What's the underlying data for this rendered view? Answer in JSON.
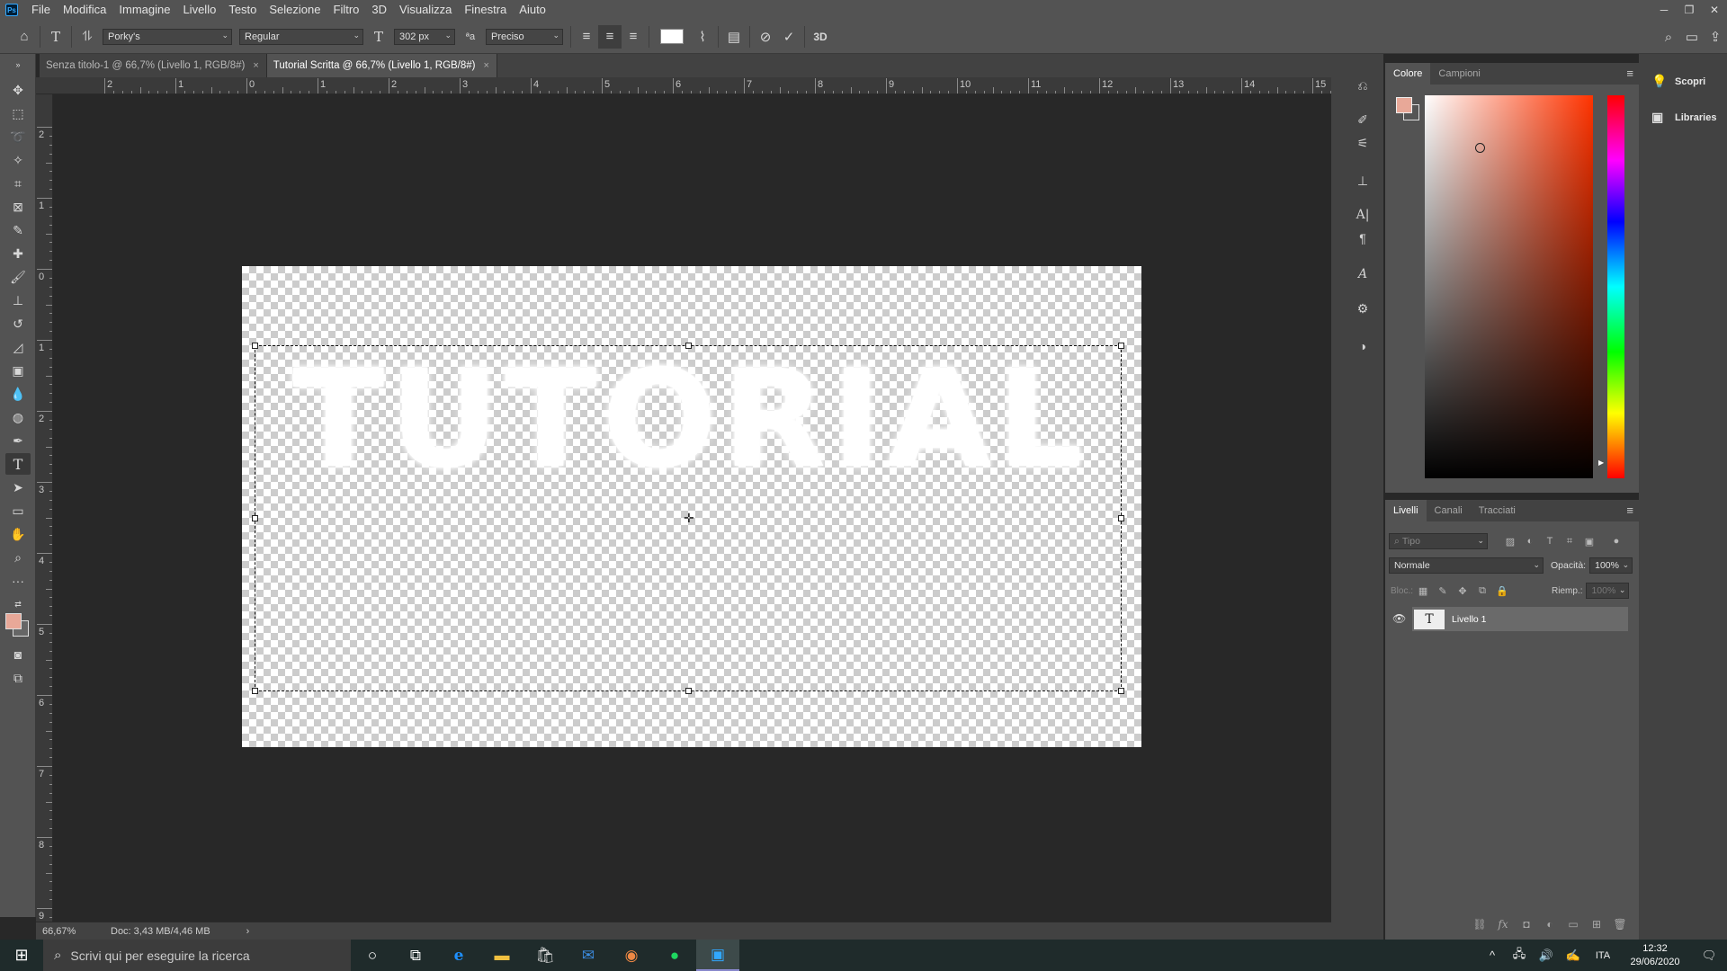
{
  "app": {
    "logo_text": "Ps",
    "name": "Adobe Photoshop"
  },
  "menu": [
    "File",
    "Modifica",
    "Immagine",
    "Livello",
    "Testo",
    "Selezione",
    "Filtro",
    "3D",
    "Visualizza",
    "Finestra",
    "Aiuto"
  ],
  "window_controls": {
    "minimize": "─",
    "restore": "❐",
    "close": "✕"
  },
  "options_bar": {
    "font_family": "Porky's",
    "font_style": "Regular",
    "font_size": "302 px",
    "antialias": "Preciso",
    "text_color": "#ffffff",
    "mode_3d": "3D"
  },
  "tabs": [
    {
      "label": "Senza titolo-1 @ 66,7% (Livello 1, RGB/8#)",
      "active": false
    },
    {
      "label": "Tutorial Scritta @ 66,7% (Livello 1, RGB/8#)",
      "active": true
    }
  ],
  "tab_close": "×",
  "ruler_top": [
    "2",
    "1",
    "0",
    "1",
    "2",
    "3",
    "4",
    "5",
    "6",
    "7",
    "8",
    "9",
    "10",
    "11",
    "12",
    "13",
    "14",
    "15"
  ],
  "ruler_left": [
    "2",
    "1",
    "0",
    "1",
    "2",
    "3",
    "4",
    "5",
    "6",
    "7",
    "8",
    "9"
  ],
  "canvas": {
    "text": "TUTORIAL"
  },
  "status": {
    "zoom": "66,67%",
    "doc": "Doc: 3,43 MB/4,46 MB",
    "arrow": "›"
  },
  "color_panel": {
    "tabs": [
      "Colore",
      "Campioni"
    ],
    "foreground": "#e8a898",
    "background": "#555555"
  },
  "layers_panel": {
    "tabs": [
      "Livelli",
      "Canali",
      "Tracciati"
    ],
    "filter_placeholder": "Tipo",
    "blend_mode": "Normale",
    "opacity_label": "Opacità:",
    "opacity": "100%",
    "lock_label": "Bloc.:",
    "fill_label": "Riemp.:",
    "fill": "100%",
    "layers": [
      {
        "name": "Livello 1",
        "type": "text",
        "thumb": "T"
      }
    ]
  },
  "right_strip": [
    {
      "icon": "lightbulb-icon",
      "label": "Scopri"
    },
    {
      "icon": "libraries-icon",
      "label": "Libraries"
    }
  ],
  "taskbar": {
    "search_placeholder": "Scrivi qui per eseguire la ricerca",
    "lang": "ITA",
    "time": "12:32",
    "date": "29/06/2020"
  }
}
